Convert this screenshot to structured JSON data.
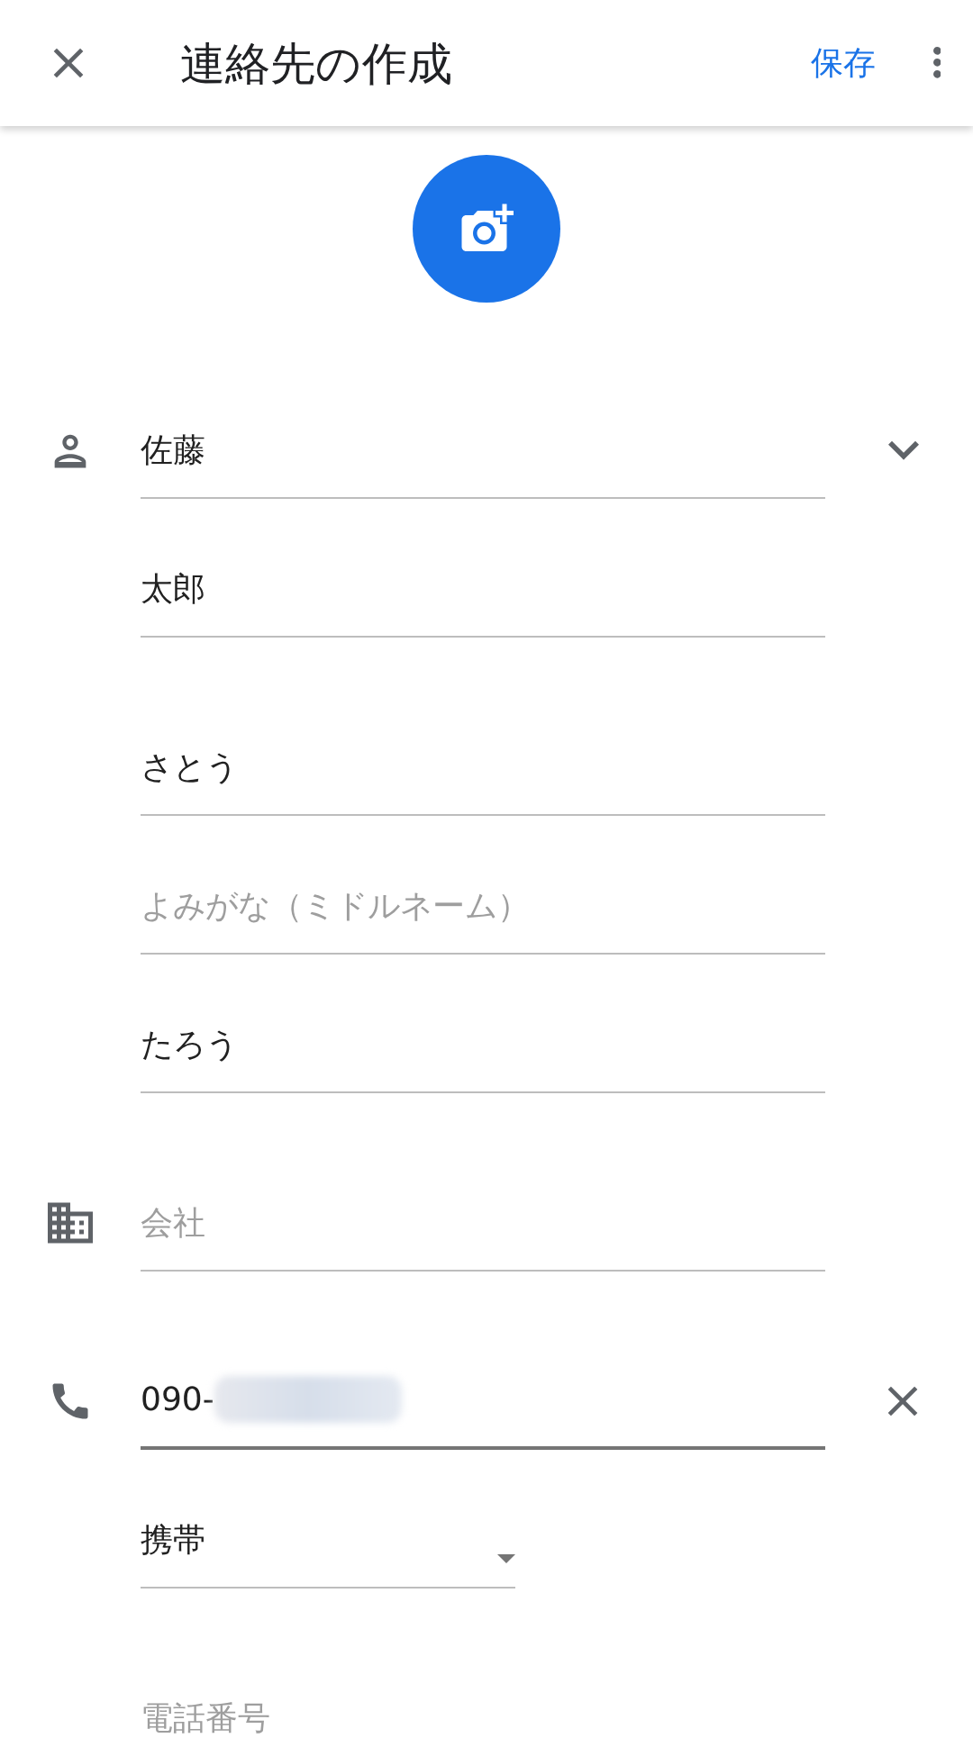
{
  "toolbar": {
    "title": "連絡先の作成",
    "save": "保存"
  },
  "name": {
    "expanded": false,
    "fields": [
      {
        "value": "佐藤"
      },
      {
        "value": "太郎"
      }
    ]
  },
  "phonetic": [
    {
      "value": "さとう"
    },
    {
      "placeholder": "よみがな（ミドルネーム）"
    },
    {
      "value": "たろう"
    }
  ],
  "company": {
    "placeholder": "会社"
  },
  "phone": {
    "value": "090-",
    "focused": true,
    "type": "携帯"
  },
  "next_phone": {
    "placeholder": "電話番号"
  }
}
